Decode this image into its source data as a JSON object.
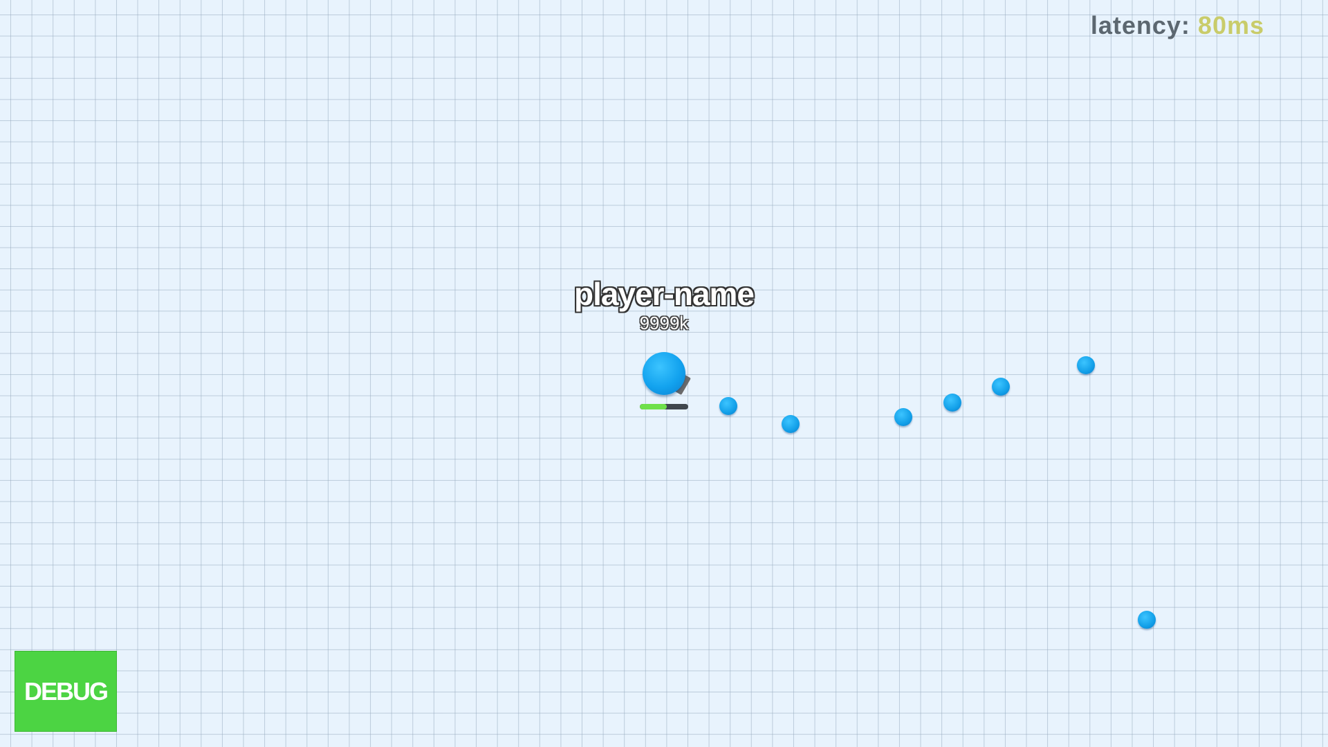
{
  "hud": {
    "latency_label": "latency:",
    "latency_value": "80ms",
    "latency_value_color": "#c9cc6a"
  },
  "player": {
    "name": "player-name",
    "score": "9999k",
    "health_fraction": 0.55,
    "color": "#12a2ee"
  },
  "bullets": [
    {
      "name": "bullet-1"
    },
    {
      "name": "bullet-2"
    },
    {
      "name": "bullet-3"
    },
    {
      "name": "bullet-4"
    },
    {
      "name": "bullet-5"
    },
    {
      "name": "bullet-6"
    },
    {
      "name": "bullet-7"
    }
  ],
  "debug_button": {
    "label": "DEBUG",
    "color": "#4cd443"
  }
}
